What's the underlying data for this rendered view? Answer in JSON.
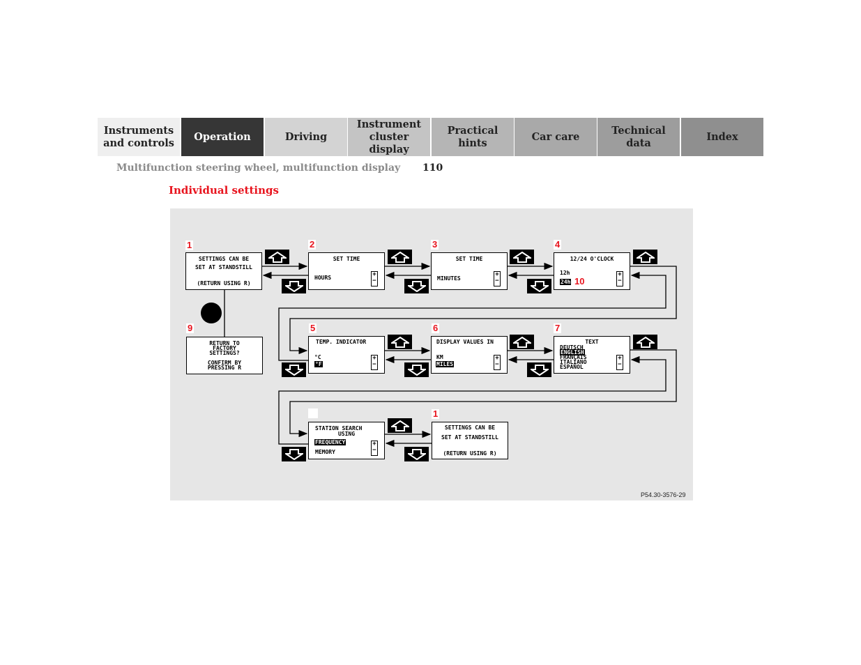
{
  "tabs": [
    {
      "label": "Instruments and controls",
      "bg": "#efefef",
      "fg": "#222"
    },
    {
      "label": "Operation",
      "bg": "#363636",
      "fg": "#fff"
    },
    {
      "label": "Driving",
      "bg": "#d3d3d3",
      "fg": "#222"
    },
    {
      "label": "Instrument cluster display",
      "bg": "#c4c4c4",
      "fg": "#222"
    },
    {
      "label": "Practical hints",
      "bg": "#b5b5b5",
      "fg": "#222"
    },
    {
      "label": "Car care",
      "bg": "#a9a9a9",
      "fg": "#222"
    },
    {
      "label": "Technical data",
      "bg": "#9d9d9d",
      "fg": "#222"
    },
    {
      "label": "Index",
      "bg": "#8f8f8f",
      "fg": "#222"
    }
  ],
  "breadcrumb": "Multifunction steering wheel, multifunction display",
  "page_number": "110",
  "section_title": "Individual settings",
  "accent": "#e8141e",
  "figure_code": "P54.30-3576-29",
  "diagram": {
    "box1": {
      "num": "1",
      "l1": "SETTINGS CAN BE",
      "l2": "SET AT STANDSTILL",
      "l3": "(RETURN USING R)"
    },
    "box2": {
      "num": "2",
      "title": "SET TIME",
      "opt": "HOURS"
    },
    "box3": {
      "num": "3",
      "title": "SET TIME",
      "opt": "MINUTES"
    },
    "box4": {
      "num": "4",
      "title": "12/24 O'CLOCK",
      "opt1": "12h",
      "opt2": "24h",
      "callout": "10"
    },
    "box5": {
      "num": "5",
      "title": "TEMP. INDICATOR",
      "opt1": "°C",
      "opt2": "°F"
    },
    "box6": {
      "num": "6",
      "title": "DISPLAY VALUES IN",
      "opt1": "KM",
      "opt2": "MILES"
    },
    "box7": {
      "num": "7",
      "title": "TEXT",
      "opts": [
        "DEUTSCH",
        "ENGLISH",
        "FRANÇAIS",
        "ITALIANO",
        "ESPAÑOL"
      ]
    },
    "box8": {
      "title1": "STATION SEARCH",
      "title2": "USING",
      "opt1": "FREQUENCY",
      "opt2": "MEMORY"
    },
    "box9": {
      "num": "9",
      "l1": "RETURN TO",
      "l2": "FACTORY",
      "l3": "SETTINGS?",
      "l4": "CONFIRM BY",
      "l5": "PRESSING R"
    },
    "box1b": {
      "num": "1",
      "l1": "SETTINGS CAN BE",
      "l2": "SET AT STANDSTILL",
      "l3": "(RETURN USING R)"
    },
    "plus": "+",
    "minus": "−"
  }
}
